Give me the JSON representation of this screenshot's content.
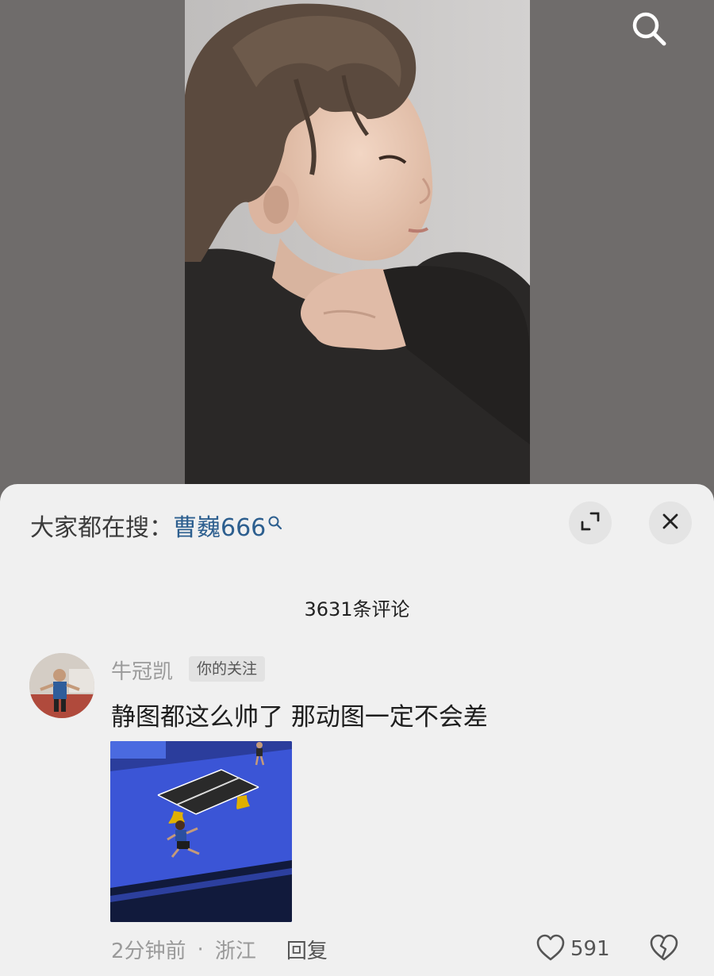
{
  "media": {
    "search_icon": "search-icon"
  },
  "sheet": {
    "hot_search_prefix": "大家都在搜：",
    "hot_search_term": "曹巍666",
    "hot_search_icon": "search-icon",
    "expand_icon": "expand-icon",
    "close_icon": "close-icon",
    "comment_count": "3631条评论"
  },
  "comment": {
    "username": "牛冠凯",
    "follow_badge": "你的关注",
    "text": "静图都这么帅了 那动图一定不会差",
    "time": "2分钟前",
    "separator": "·",
    "location": "浙江",
    "reply_label": "回复",
    "like_count": "591",
    "like_icon": "heart-icon",
    "dislike_icon": "broken-heart-icon"
  },
  "colors": {
    "link": "#2d5f8f",
    "sheet_bg": "#f0f0f0",
    "backdrop": "#6f6c6b"
  }
}
